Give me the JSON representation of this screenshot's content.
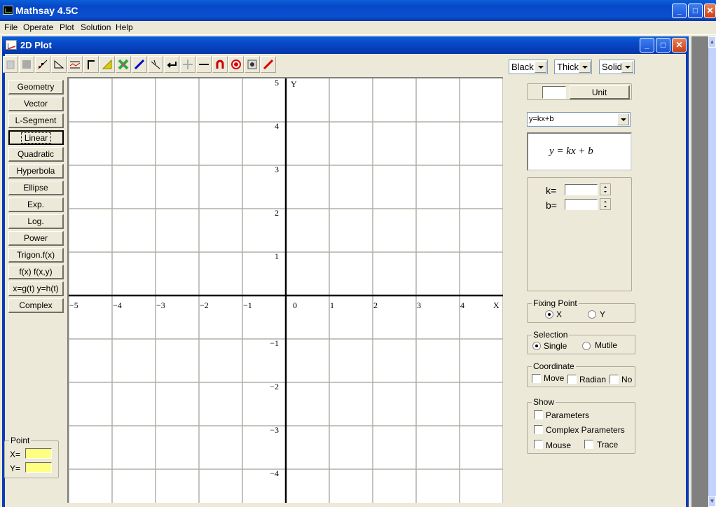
{
  "app": {
    "title": "Mathsay 4.5C",
    "menu": [
      "File",
      "Operate",
      "Plot",
      "Solution",
      "Help"
    ]
  },
  "child_window": {
    "title": "2D Plot"
  },
  "toolbar": {
    "icons": [
      "document-icon",
      "page-icon",
      "scatter-plot-icon",
      "triangle-ruler-icon",
      "chart-lines-icon",
      "corner-icon",
      "protractor-icon",
      "colors-cross-icon",
      "pen-icon",
      "compass-icon",
      "return-arrow-icon",
      "plus-icon",
      "minus-icon",
      "magnet-icon",
      "target-icon",
      "clock-icon",
      "pencil-icon"
    ]
  },
  "style_selects": {
    "color": "Black",
    "thickness": "Thick",
    "line": "Solid"
  },
  "left_buttons": [
    {
      "label": "Geometry"
    },
    {
      "label": "Vector"
    },
    {
      "label": "L-Segment"
    },
    {
      "label": "Linear",
      "focused": true
    },
    {
      "label": "Quadratic"
    },
    {
      "label": "Hyperbola"
    },
    {
      "label": "Ellipse"
    },
    {
      "label": "Exp."
    },
    {
      "label": "Log."
    },
    {
      "label": "Power"
    },
    {
      "label": "Trigon.f(x)"
    },
    {
      "label": "f(x)  f(x,y)"
    },
    {
      "label": "x=g(t) y=h(t)"
    },
    {
      "label": "Complex"
    }
  ],
  "point": {
    "legend": "Point",
    "x_label": "X=",
    "y_label": "Y=",
    "x_value": "",
    "y_value": ""
  },
  "plot": {
    "x_axis_label": "X",
    "y_axis_label": "Y",
    "x_ticks": [
      "−5",
      "−4",
      "−3",
      "−2",
      "−1",
      "0",
      "1",
      "2",
      "3",
      "4"
    ],
    "y_ticks_pos": [
      "5",
      "4",
      "3",
      "2",
      "1"
    ],
    "y_ticks_neg": [
      "−1",
      "−2",
      "−3",
      "−4"
    ],
    "x_range": [
      -5,
      5
    ],
    "y_range": [
      -4.8,
      5
    ]
  },
  "right_panel": {
    "unit_value": "",
    "unit_label": "Unit",
    "function_select": "y=kx+b",
    "equation_display": "y = kx + b",
    "params": [
      {
        "label": "k=",
        "value": ""
      },
      {
        "label": "b=",
        "value": ""
      }
    ],
    "fixing_point": {
      "legend": "Fixing Point",
      "options": [
        "X",
        "Y"
      ],
      "selected": "X"
    },
    "selection": {
      "legend": "Selection",
      "options": [
        "Single",
        "Mutile"
      ],
      "selected": "Single"
    },
    "coordinate": {
      "legend": "Coordinate",
      "options": [
        {
          "label": "Move",
          "checked": false
        },
        {
          "label": "Radian",
          "checked": false
        },
        {
          "label": "No",
          "checked": false
        }
      ]
    },
    "show": {
      "legend": "Show",
      "options": [
        {
          "label": "Parameters",
          "checked": false
        },
        {
          "label": "Complex Parameters",
          "checked": false
        },
        {
          "label": "Mouse",
          "checked": false
        },
        {
          "label": "Trace",
          "checked": false
        }
      ]
    }
  }
}
